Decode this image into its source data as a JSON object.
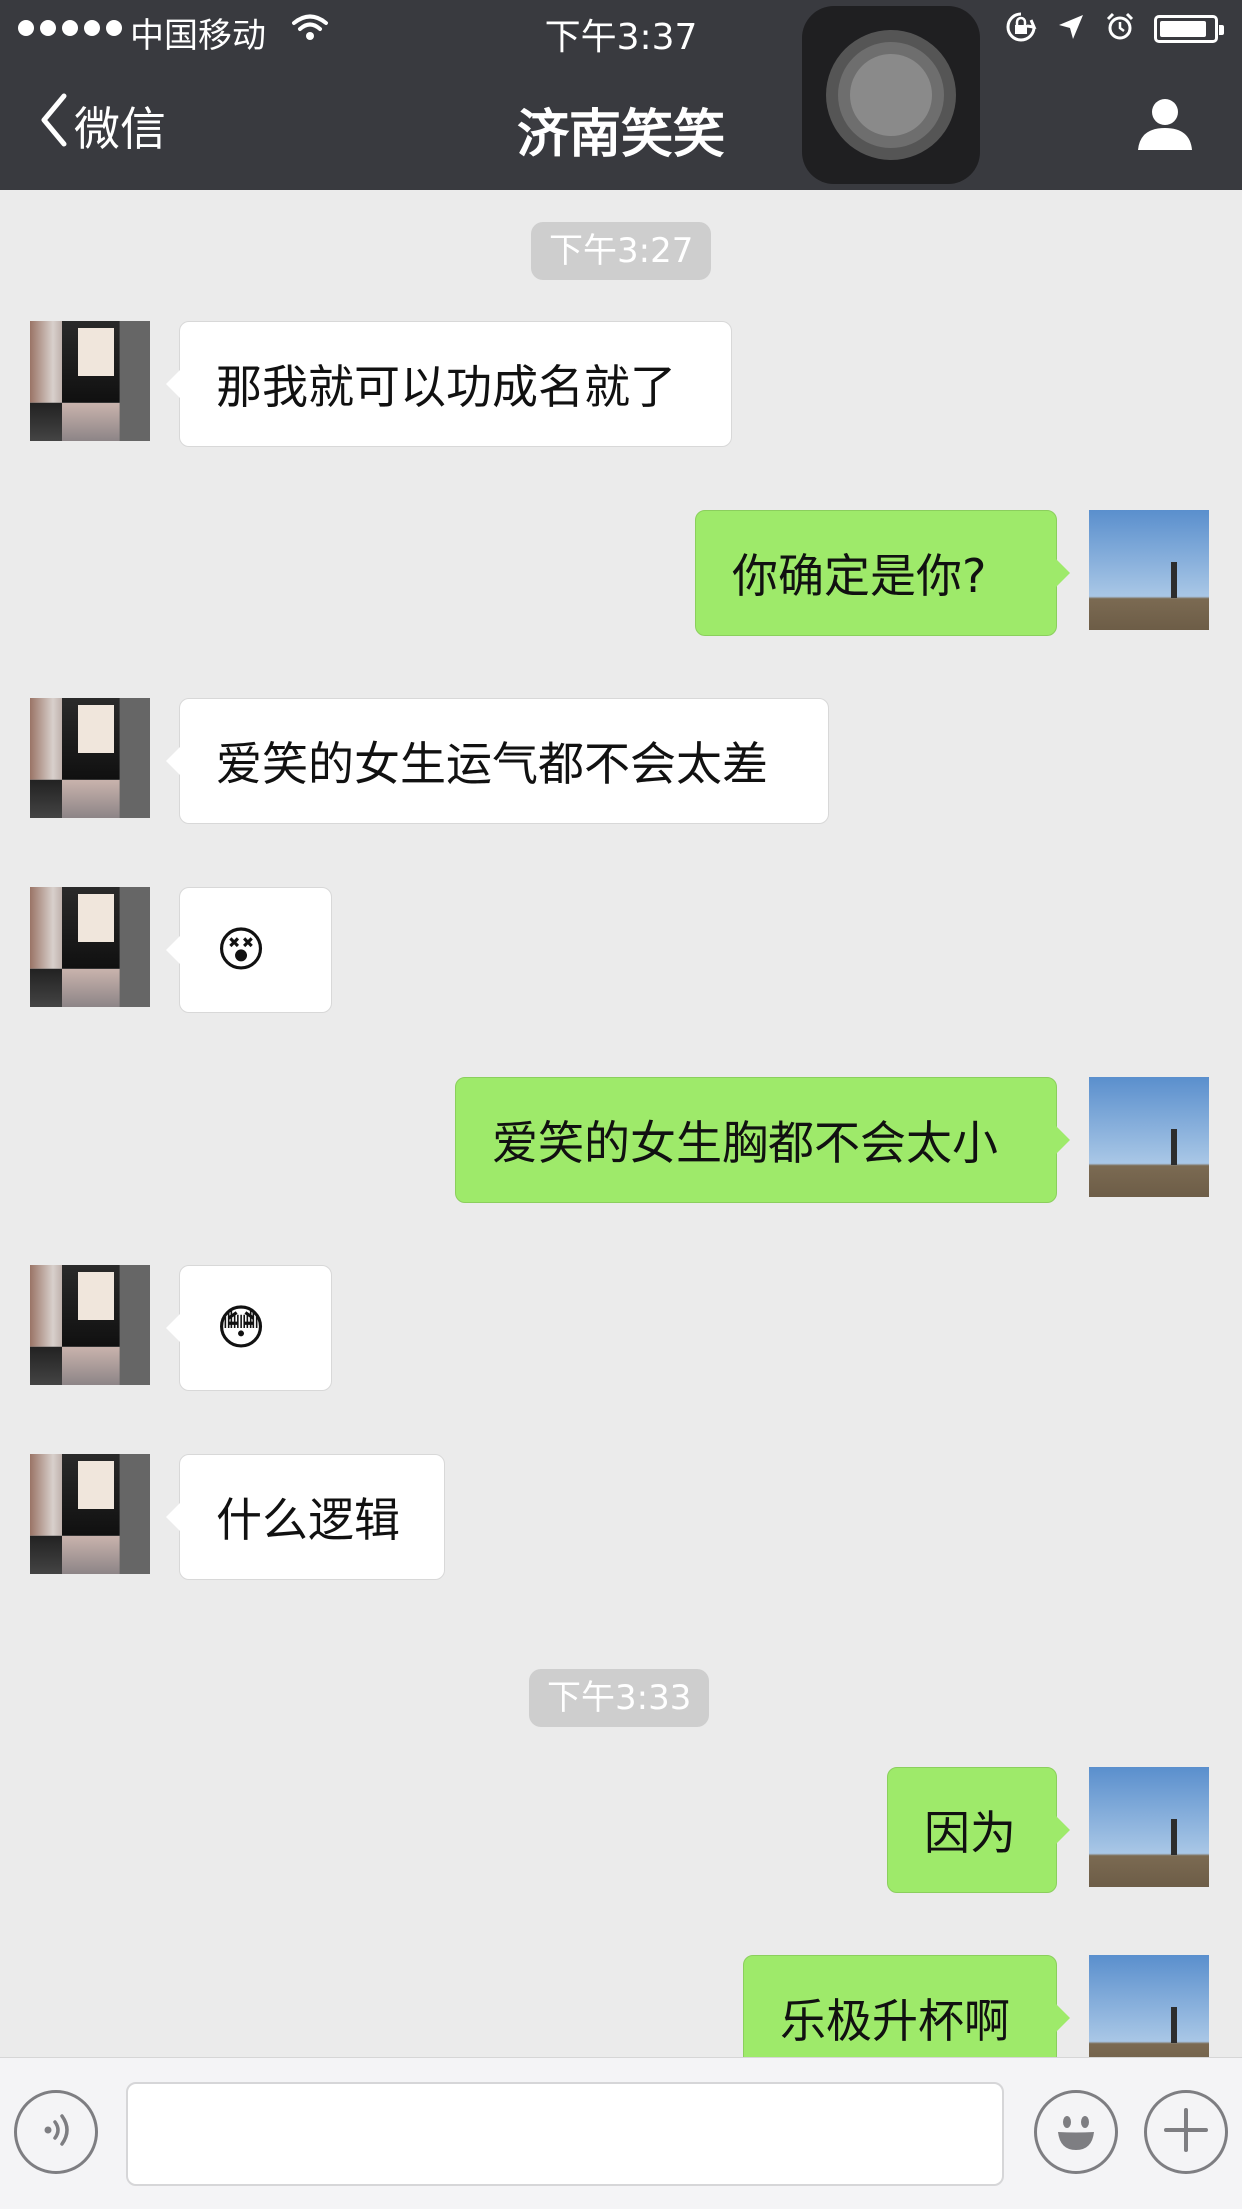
{
  "status_bar": {
    "carrier": "中国移动",
    "time": "下午3:37"
  },
  "nav": {
    "back_label": "微信",
    "title": "济南笑笑"
  },
  "chat": {
    "timestamps": [
      "下午3:27",
      "下午3:33"
    ],
    "messages": [
      {
        "from": "them",
        "text": "那我就可以功成名就了"
      },
      {
        "from": "me",
        "text": "你确定是你?"
      },
      {
        "from": "them",
        "text": "爱笑的女生运气都不会太差"
      },
      {
        "from": "them",
        "text": "😵"
      },
      {
        "from": "me",
        "text": "爱笑的女生胸都不会太小"
      },
      {
        "from": "them",
        "text": "😳"
      },
      {
        "from": "them",
        "text": "什么逻辑"
      },
      {
        "from": "me",
        "text": "因为"
      },
      {
        "from": "me",
        "text": "乐极升杯啊"
      }
    ]
  },
  "input_bar": {
    "text_value": "",
    "voice_icon": "voice-icon",
    "emoji_icon": "emoji-icon",
    "plus_icon": "plus-icon"
  },
  "colors": {
    "header_bg": "#393a3f",
    "chat_bg": "#ebebeb",
    "outgoing_bubble": "#9eea6a",
    "incoming_bubble": "#ffffff"
  }
}
